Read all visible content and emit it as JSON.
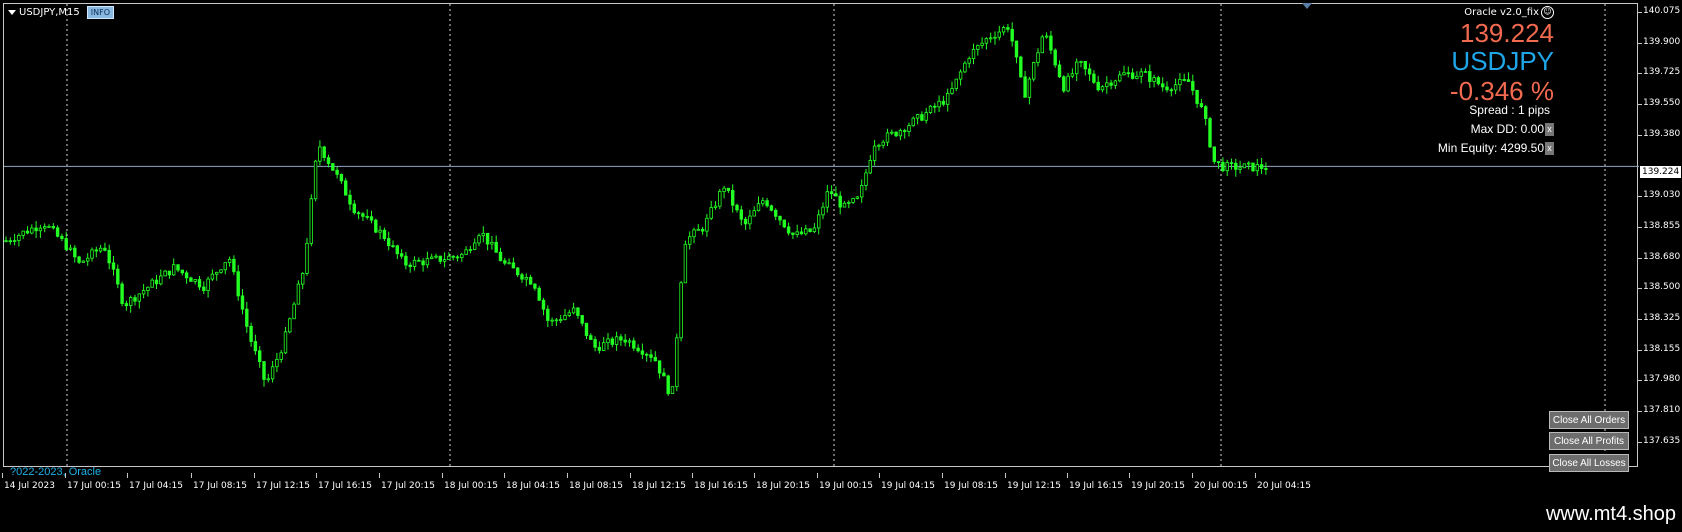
{
  "chart": {
    "symbol_label": "USDJPY,M15",
    "info_badge": "INFO",
    "ea_name": "Oracle v2.0_fix",
    "current_price_display": "139.224",
    "symbol_display": "USDJPY",
    "change_pct": "-0.346 %",
    "spread": "Spread : 1 pips",
    "max_dd": "Max DD: 0.00",
    "min_equity": "Min Equity: 4299.50",
    "copyright": "?022-2023, Oracle",
    "current_price_tag": "139.224",
    "colors": {
      "candle": "#22ff22",
      "price_red": "#f26a4f",
      "symbol_blue": "#1fa6e8",
      "grid": "#ffffff",
      "bid_line": "#8ea7c2"
    }
  },
  "buttons": {
    "close_all_orders": "Close All Orders",
    "close_all_profits": "Close All Profits",
    "close_all_losses": "Close All Losses"
  },
  "axis": {
    "y_ticks": [
      "140.075",
      "139.900",
      "139.725",
      "139.550",
      "139.380",
      "139.030",
      "138.855",
      "138.680",
      "138.500",
      "138.325",
      "138.155",
      "137.980",
      "137.810",
      "137.635"
    ],
    "x_ticks": [
      "14 Jul 2023",
      "17 Jul 00:15",
      "17 Jul 04:15",
      "17 Jul 08:15",
      "17 Jul 12:15",
      "17 Jul 16:15",
      "17 Jul 20:15",
      "18 Jul 00:15",
      "18 Jul 04:15",
      "18 Jul 08:15",
      "18 Jul 12:15",
      "18 Jul 16:15",
      "18 Jul 20:15",
      "19 Jul 00:15",
      "19 Jul 04:15",
      "19 Jul 08:15",
      "19 Jul 12:15",
      "19 Jul 16:15",
      "19 Jul 20:15",
      "20 Jul 00:15",
      "20 Jul 04:15"
    ]
  },
  "chart_data": {
    "type": "candlestick",
    "ylim": [
      137.635,
      140.075
    ],
    "current_price": 139.224,
    "path": [
      [
        0,
        138.82
      ],
      [
        40,
        138.92
      ],
      [
        62,
        138.8
      ],
      [
        75,
        138.7
      ],
      [
        100,
        138.8
      ],
      [
        120,
        138.48
      ],
      [
        150,
        138.6
      ],
      [
        170,
        138.68
      ],
      [
        200,
        138.58
      ],
      [
        225,
        138.74
      ],
      [
        245,
        138.32
      ],
      [
        262,
        138.05
      ],
      [
        280,
        138.28
      ],
      [
        300,
        138.68
      ],
      [
        314,
        139.35
      ],
      [
        330,
        139.2
      ],
      [
        350,
        139.0
      ],
      [
        380,
        138.85
      ],
      [
        400,
        138.7
      ],
      [
        430,
        138.72
      ],
      [
        460,
        138.75
      ],
      [
        476,
        138.88
      ],
      [
        500,
        138.7
      ],
      [
        530,
        138.6
      ],
      [
        545,
        138.38
      ],
      [
        570,
        138.45
      ],
      [
        590,
        138.25
      ],
      [
        620,
        138.3
      ],
      [
        650,
        138.2
      ],
      [
        668,
        137.98
      ],
      [
        680,
        138.82
      ],
      [
        700,
        138.9
      ],
      [
        720,
        139.12
      ],
      [
        740,
        138.9
      ],
      [
        760,
        139.05
      ],
      [
        790,
        138.85
      ],
      [
        810,
        138.88
      ],
      [
        825,
        139.1
      ],
      [
        840,
        139.0
      ],
      [
        855,
        139.05
      ],
      [
        870,
        139.35
      ],
      [
        890,
        139.4
      ],
      [
        920,
        139.5
      ],
      [
        945,
        139.6
      ],
      [
        965,
        139.82
      ],
      [
        985,
        139.92
      ],
      [
        1005,
        139.98
      ],
      [
        1020,
        139.6
      ],
      [
        1040,
        139.95
      ],
      [
        1060,
        139.65
      ],
      [
        1075,
        139.78
      ],
      [
        1095,
        139.65
      ],
      [
        1120,
        139.72
      ],
      [
        1140,
        139.72
      ],
      [
        1160,
        139.65
      ],
      [
        1185,
        139.68
      ],
      [
        1200,
        139.5
      ],
      [
        1210,
        139.25
      ],
      [
        1220,
        139.22
      ]
    ]
  }
}
